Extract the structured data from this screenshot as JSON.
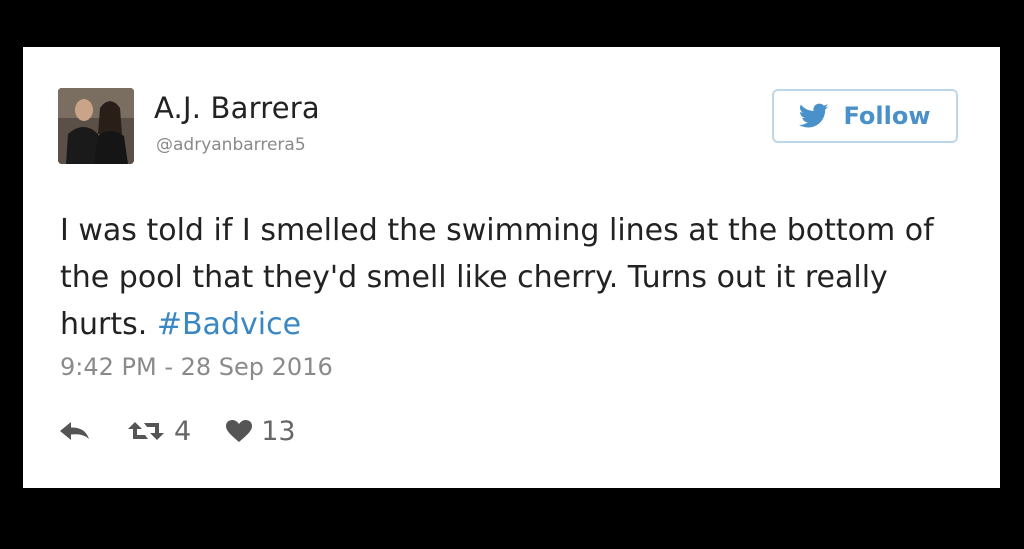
{
  "tweet": {
    "author_name": "A.J. Barrera",
    "author_handle": "@adryanbarrera5",
    "follow_label": "Follow",
    "text": "I was told if I smelled the swimming lines at the bottom of the pool that they'd smell like cherry. Turns out it really hurts.",
    "hashtag": "#Badvice",
    "timestamp": "9:42 PM - 28 Sep 2016",
    "retweet_count": "4",
    "like_count": "13"
  },
  "icons": {
    "follow": "twitter-bird-icon",
    "reply": "reply-icon",
    "retweet": "retweet-icon",
    "like": "heart-icon"
  },
  "colors": {
    "background": "#000000",
    "card": "#ffffff",
    "accent": "#4a91c9",
    "hashtag": "#3a87c1",
    "muted": "#8a8a8a"
  }
}
